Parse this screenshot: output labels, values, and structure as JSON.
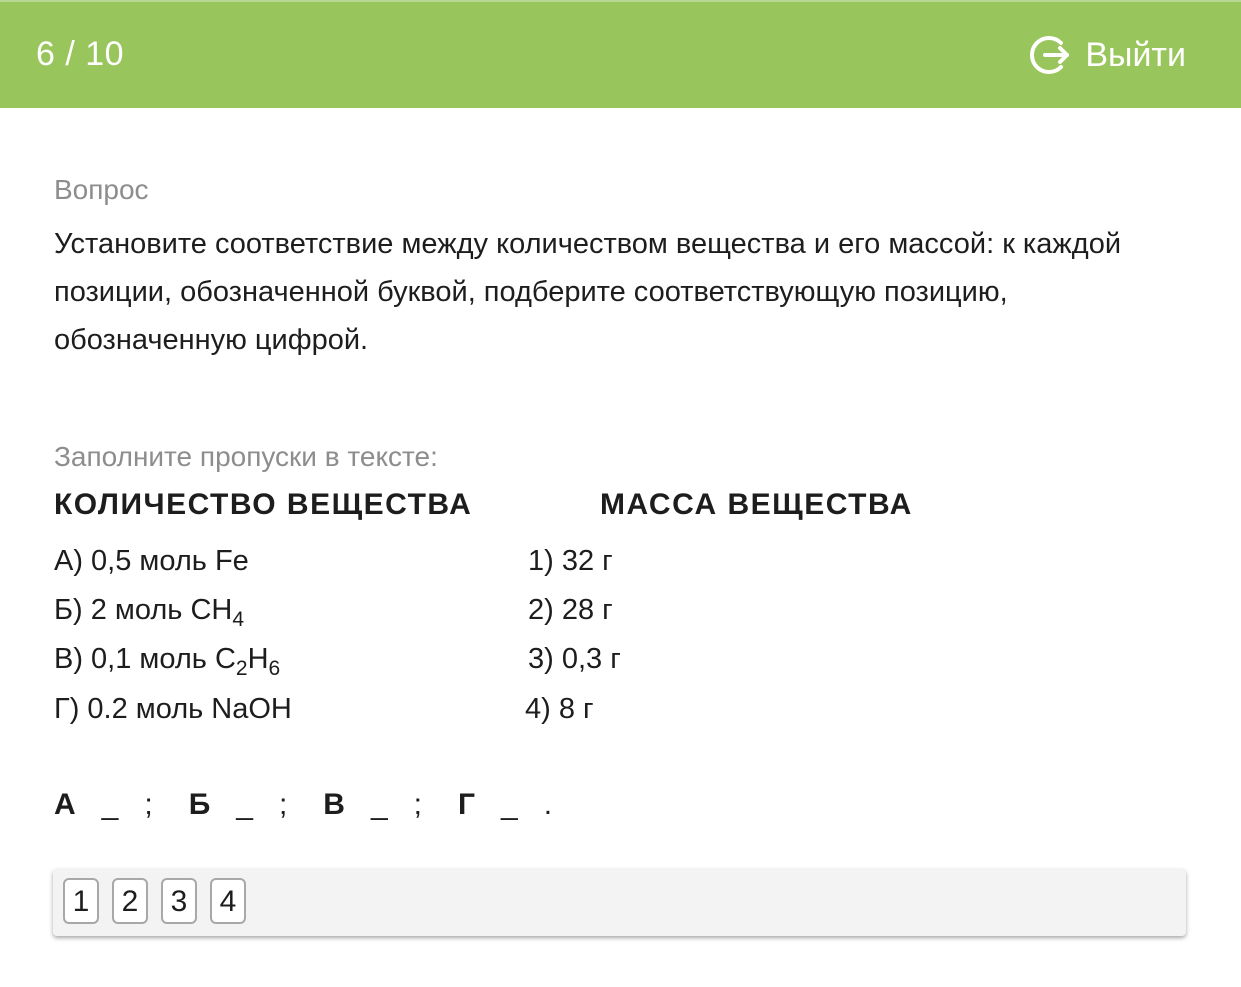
{
  "header": {
    "progress": "6 / 10",
    "exit_label": "Выйти",
    "exit_icon": "logout-icon",
    "bg_color": "#99c55d"
  },
  "question": {
    "label": "Вопрос",
    "text": "Установите соответствие между количеством вещества и его массой: к каждой позиции, обозначенной буквой, подберите соответствующую позицию, обозначенную цифрой."
  },
  "task": {
    "instruction": "Заполните пропуски в тексте:",
    "left_header": "КОЛИЧЕСТВО ВЕЩЕСТВА",
    "right_header": "МАССА ВЕЩЕСТВА",
    "left_items": [
      {
        "prefix": "А) 0,5 моль Fe",
        "sub1": "",
        "mid": "",
        "sub2": ""
      },
      {
        "prefix": "Б) 2 моль CH",
        "sub1": "4",
        "mid": "",
        "sub2": ""
      },
      {
        "prefix": "В) 0,1 моль C",
        "sub1": "2",
        "mid": "H",
        "sub2": "6"
      },
      {
        "prefix": "Г) 0.2 моль NaOH",
        "sub1": "",
        "mid": "",
        "sub2": ""
      }
    ],
    "right_items": [
      "1) 32 г",
      "2) 28 г",
      "3) 0,3 г",
      "4) 8 г"
    ]
  },
  "answer": {
    "slots": [
      {
        "letter": "А",
        "blank": "_",
        "sep": ";"
      },
      {
        "letter": "Б",
        "blank": "_",
        "sep": ";"
      },
      {
        "letter": "В",
        "blank": "_",
        "sep": ";"
      },
      {
        "letter": "Г",
        "blank": "_",
        "sep": "."
      }
    ]
  },
  "options": [
    "1",
    "2",
    "3",
    "4"
  ]
}
